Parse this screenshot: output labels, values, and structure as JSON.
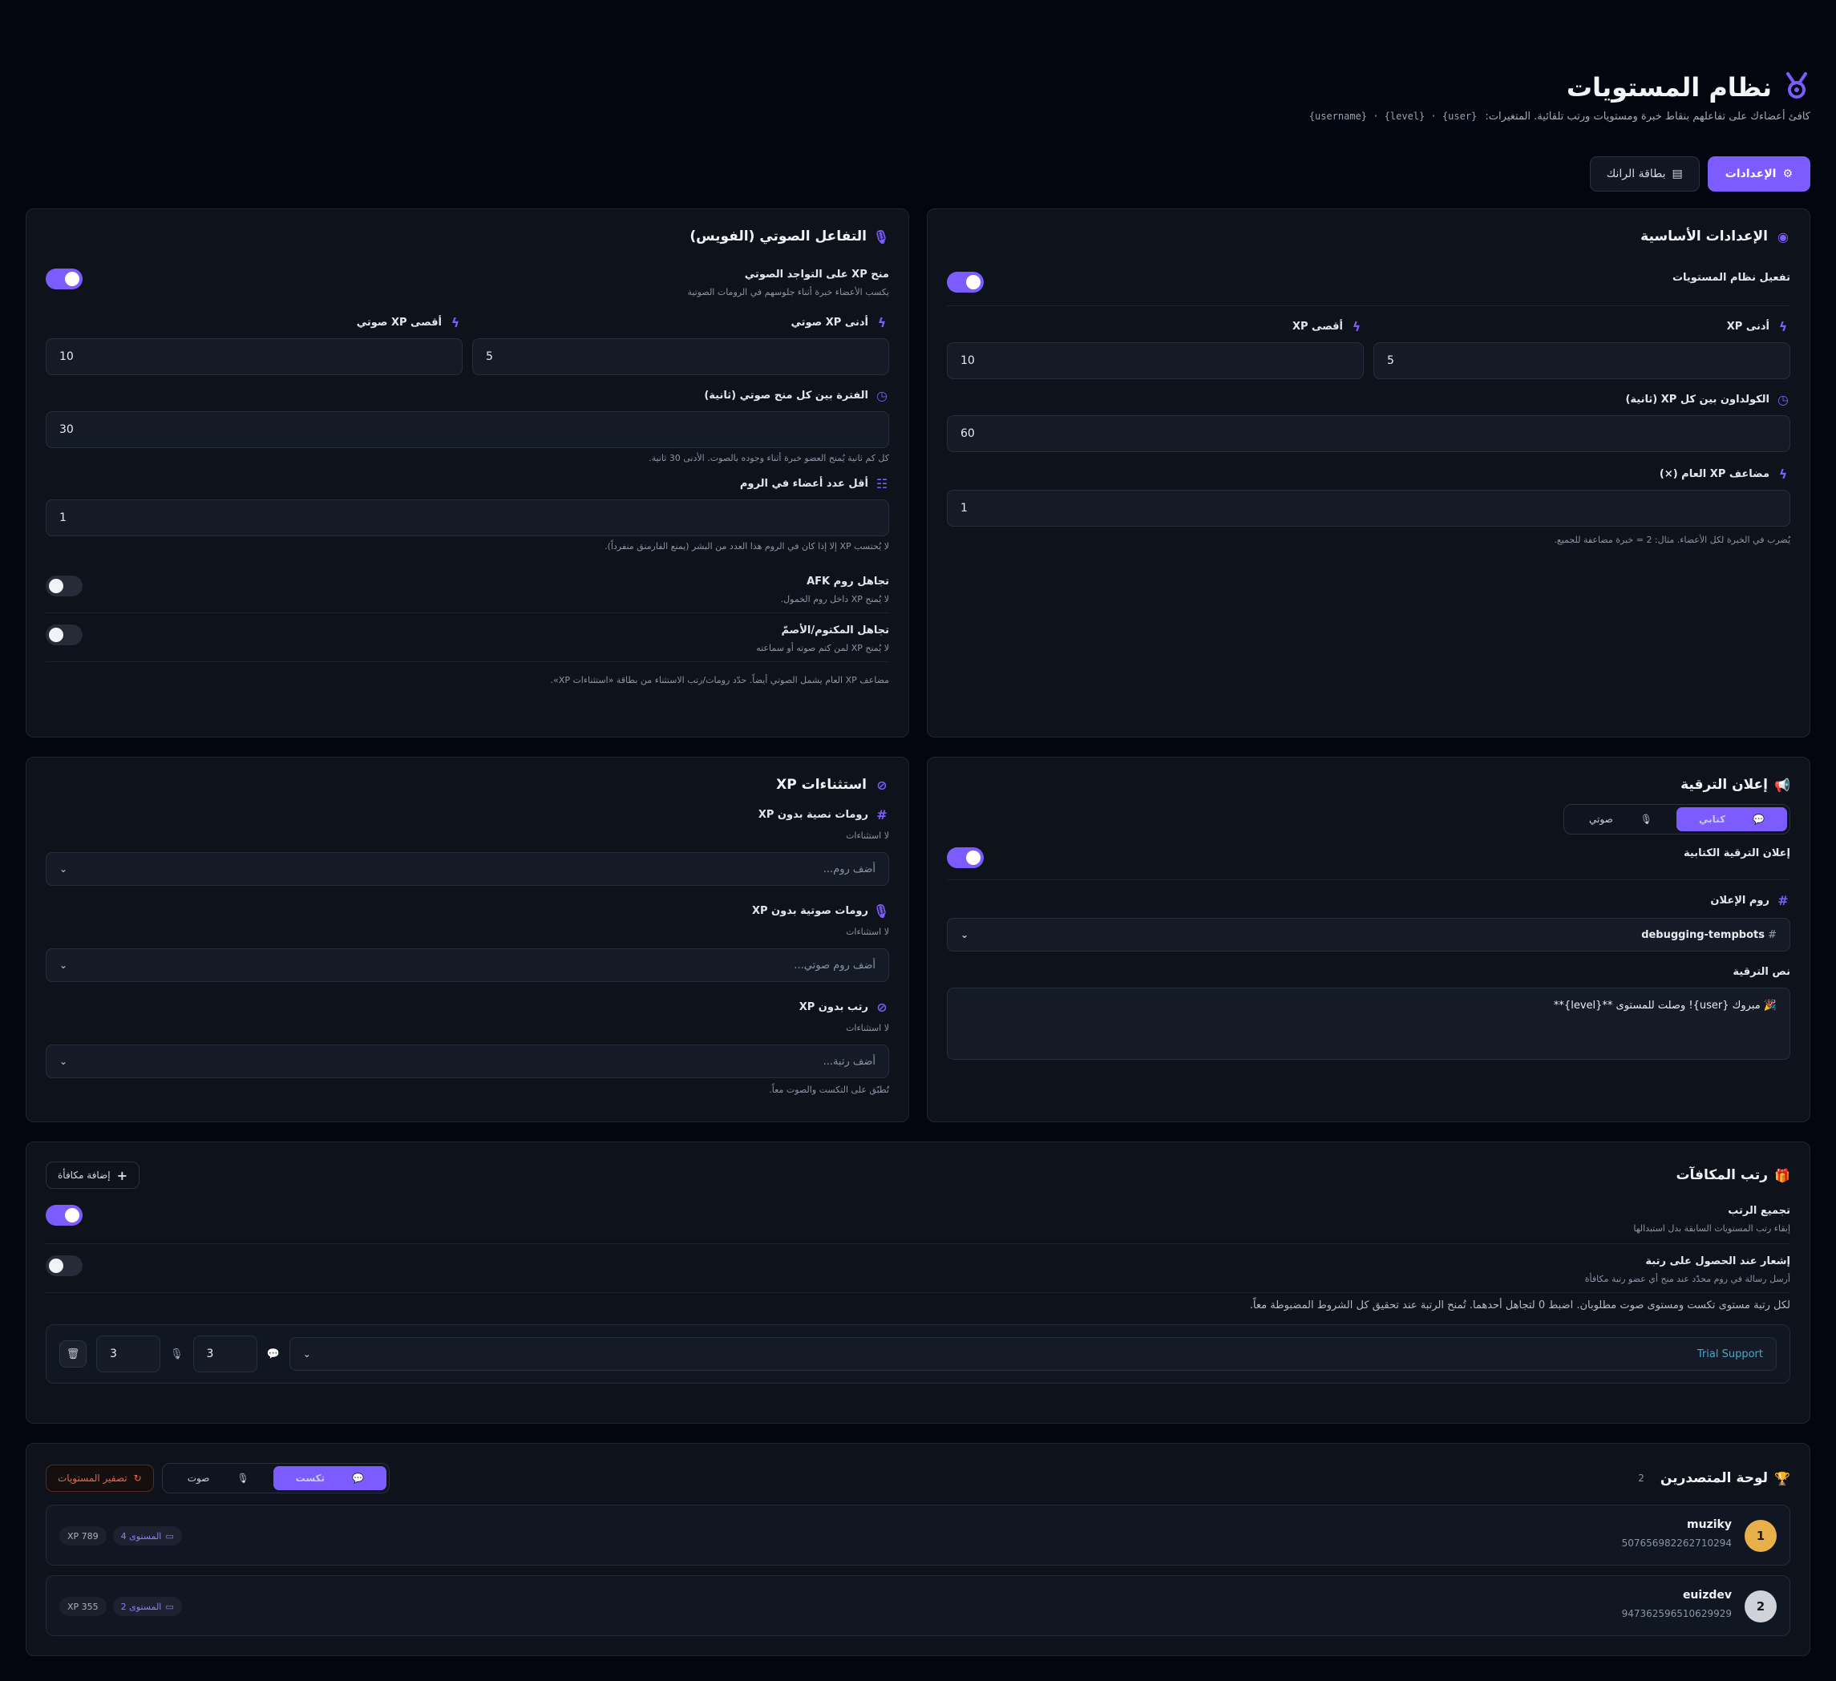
{
  "header": {
    "title": "نظام المستويات",
    "subtitle": "كافئ أعضاءك على تفاعلهم بنقاط خبرة ومستويات ورتب تلقائية. المتغيرات:",
    "variables": "{username} · {level} · {user}",
    "settings_button": "الإعدادات",
    "rank_card_button": "بطاقة الرانك"
  },
  "basic": {
    "title": "الإعدادات الأساسية",
    "enable_label": "تفعيل نظام المستويات",
    "min_xp_label": "أدنى XP",
    "max_xp_label": "أقصى XP",
    "min_xp": "5",
    "max_xp": "10",
    "cooldown_label": "الكولداون بين كل XP (ثانية)",
    "cooldown": "60",
    "multiplier_label": "مضاعف XP العام (×)",
    "multiplier": "1",
    "multiplier_hint": "يُضرب في الخبرة لكل الأعضاء. مثال: 2 = خبرة مضاعفة للجميع."
  },
  "voice": {
    "title": "التفاعل الصوتي (الفويس)",
    "grant_label": "منح XP على التواجد الصوتي",
    "grant_hint": "يكسب الأعضاء خبرة أثناء جلوسهم في الرومات الصوتية",
    "min_label": "أدنى XP صوتي",
    "max_label": "أقصى XP صوتي",
    "min": "5",
    "max": "10",
    "interval_label": "الفترة بين كل منح صوتي (ثانية)",
    "interval": "30",
    "interval_hint": "كل كم ثانية يُمنح العضو خبرة أثناء وجوده بالصوت. الأدنى 30 ثانية.",
    "min_members_label": "أقل عدد أعضاء في الروم",
    "min_members": "1",
    "min_members_hint": "لا يُحتسب XP إلا إذا كان في الروم هذا العدد من البشر (يمنع الفارمنق منفرداً).",
    "afk_label": "تجاهل روم AFK",
    "afk_hint": "لا يُمنح XP داخل روم الخمول.",
    "muted_label": "تجاهل المكتوم/الأصمّ",
    "muted_hint": "لا يُمنح XP لمن كتم صوته أو سماعته",
    "footer_note": "مضاعف XP العام يشمل الصوتي أيضاً. حدّد رومات/رتب الاستثناء من بطاقة «استثناءات XP»."
  },
  "announce": {
    "title": "إعلان الترقية",
    "tab_text": "كتابي",
    "tab_voice": "صوتي",
    "enable_label": "إعلان الترقية الكتابية",
    "channel_label": "روم الإعلان",
    "channel": "debugging-tempbots",
    "message_label": "نص الترقية",
    "message": "🎉 مبروك {user}! وصلت للمستوى **{level}**"
  },
  "exceptions": {
    "title": "استثناءات XP",
    "text_label": "رومات نصية بدون XP",
    "text_none": "لا استثناءات",
    "text_placeholder": "أضف روم...",
    "voice_label": "رومات صوتية بدون XP",
    "voice_none": "لا استثناءات",
    "voice_placeholder": "أضف روم صوتي...",
    "roles_label": "رتب بدون XP",
    "roles_none": "لا استثناءات",
    "roles_placeholder": "أضف رتبة...",
    "footer": "تُطبّق على التكست والصوت معاً."
  },
  "rewards": {
    "title": "رتب المكافآت",
    "add_button": "إضافة مكافأة",
    "stack_label": "تجميع الرتب",
    "stack_hint": "إبقاء رتب المستويات السابقة بدل استبدالها",
    "notify_label": "إشعار عند الحصول على رتبة",
    "notify_hint": "أرسل رسالة في روم محدّد عند منح أي عضو رتبة مكافأة",
    "note": "لكل رتبة مستوى تكست ومستوى صوت مطلوبان. اضبط 0 لتجاهل أحدهما. تُمنح الرتبة عند تحقيق كل الشروط المضبوطة معاً.",
    "row": {
      "role": "Trial Support",
      "role_color": "#4aa6c9",
      "text_level": "3",
      "voice_level": "3"
    }
  },
  "leaderboard": {
    "title": "لوحة المتصدرين",
    "count": "2",
    "tab_text": "تكست",
    "tab_voice": "صوت",
    "reset_button": "تصفير المستويات",
    "entries": [
      {
        "rank": "1",
        "name": "muziky",
        "id": "507656982262710294",
        "level": "المستوى 4",
        "xp": "789 XP",
        "rank_color": "#e8b04a"
      },
      {
        "rank": "2",
        "name": "euizdev",
        "id": "947362596510629929",
        "level": "المستوى 2",
        "xp": "355 XP",
        "rank_color": "#cfd2d9"
      }
    ]
  },
  "colors": {
    "accent": "#7c5cff",
    "background": "#03060e",
    "card": "#0d121b",
    "danger": "#e06a4a"
  }
}
